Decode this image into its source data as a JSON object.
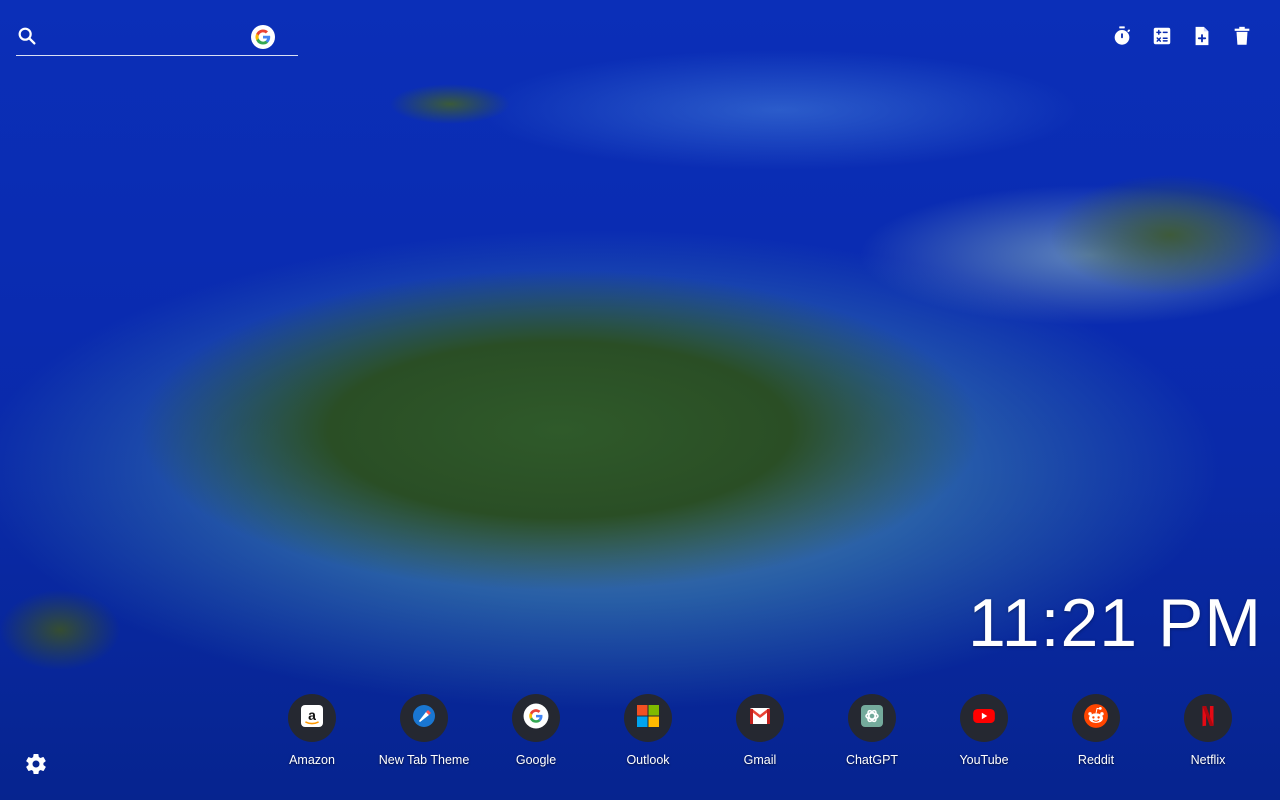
{
  "search": {
    "placeholder": "",
    "engine_icon": "google-g-icon"
  },
  "toolbar": {
    "items": [
      {
        "icon": "timer-icon"
      },
      {
        "icon": "calculator-icon"
      },
      {
        "icon": "new-note-icon"
      },
      {
        "icon": "trash-icon"
      }
    ]
  },
  "clock": {
    "time": "11:21 PM"
  },
  "shortcuts": [
    {
      "label": "Amazon",
      "icon": "amazon-icon"
    },
    {
      "label": "New Tab Theme",
      "icon": "new-tab-theme-icon"
    },
    {
      "label": "Google",
      "icon": "google-icon"
    },
    {
      "label": "Outlook",
      "icon": "microsoft-icon"
    },
    {
      "label": "Gmail",
      "icon": "gmail-icon"
    },
    {
      "label": "ChatGPT",
      "icon": "chatgpt-icon"
    },
    {
      "label": "YouTube",
      "icon": "youtube-icon"
    },
    {
      "label": "Reddit",
      "icon": "reddit-icon"
    },
    {
      "label": "Netflix",
      "icon": "netflix-icon"
    }
  ],
  "settings": {
    "icon": "gear-icon"
  },
  "colors": {
    "ocean": "#0a2bb0",
    "shortcut_bg": "#282828",
    "text": "#ffffff"
  }
}
